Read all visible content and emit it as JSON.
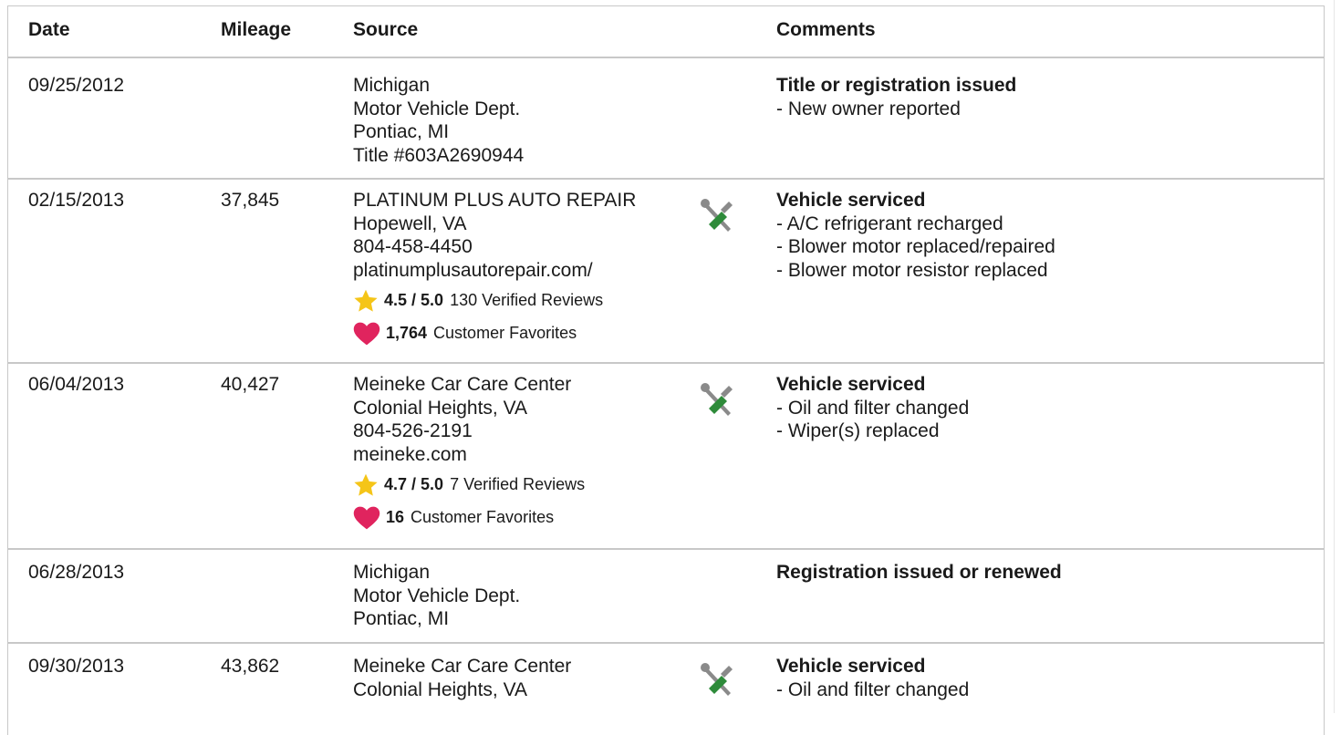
{
  "table": {
    "headers": {
      "date": "Date",
      "mileage": "Mileage",
      "source": "Source",
      "comments": "Comments"
    },
    "rows": [
      {
        "date": "09/25/2012",
        "mileage": "",
        "source": [
          "Michigan",
          "Motor Vehicle Dept.",
          "Pontiac, MI",
          "Title #603A2690944"
        ],
        "comment_title": "Title or registration issued",
        "comment_items": [
          "New owner reported"
        ]
      },
      {
        "date": "02/15/2013",
        "mileage": "37,845",
        "source": [
          "PLATINUM PLUS AUTO REPAIR",
          "Hopewell, VA",
          "804-458-4450",
          "platinumplusautorepair.com/"
        ],
        "rating": {
          "score": "4.5 / 5.0",
          "reviews": "130 Verified Reviews"
        },
        "favorites": {
          "count": "1,764",
          "label": "Customer Favorites"
        },
        "icon": "service-tools-icon",
        "comment_title": "Vehicle serviced",
        "comment_items": [
          "A/C refrigerant recharged",
          "Blower motor replaced/repaired",
          "Blower motor resistor replaced"
        ]
      },
      {
        "date": "06/04/2013",
        "mileage": "40,427",
        "source": [
          "Meineke Car Care Center",
          "Colonial Heights, VA",
          "804-526-2191",
          "meineke.com"
        ],
        "rating": {
          "score": "4.7 / 5.0",
          "reviews": "7 Verified Reviews"
        },
        "favorites": {
          "count": "16",
          "label": "Customer Favorites"
        },
        "icon": "service-tools-icon",
        "comment_title": "Vehicle serviced",
        "comment_items": [
          "Oil and filter changed",
          "Wiper(s) replaced"
        ]
      },
      {
        "date": "06/28/2013",
        "mileage": "",
        "source": [
          "Michigan",
          "Motor Vehicle Dept.",
          "Pontiac, MI"
        ],
        "comment_title": "Registration issued or renewed",
        "comment_items": []
      },
      {
        "date": "09/30/2013",
        "mileage": "43,862",
        "source": [
          "Meineke Car Care Center",
          "Colonial Heights, VA"
        ],
        "icon": "service-tools-icon",
        "comment_title": "Vehicle serviced",
        "comment_items": [
          "Oil and filter changed"
        ]
      }
    ]
  },
  "colors": {
    "border": "#c8c8c8",
    "star": "#f5c518",
    "heart": "#e0245e",
    "wrench_gray": "#8a8a8a",
    "screwdriver_green": "#2e8b3a"
  }
}
